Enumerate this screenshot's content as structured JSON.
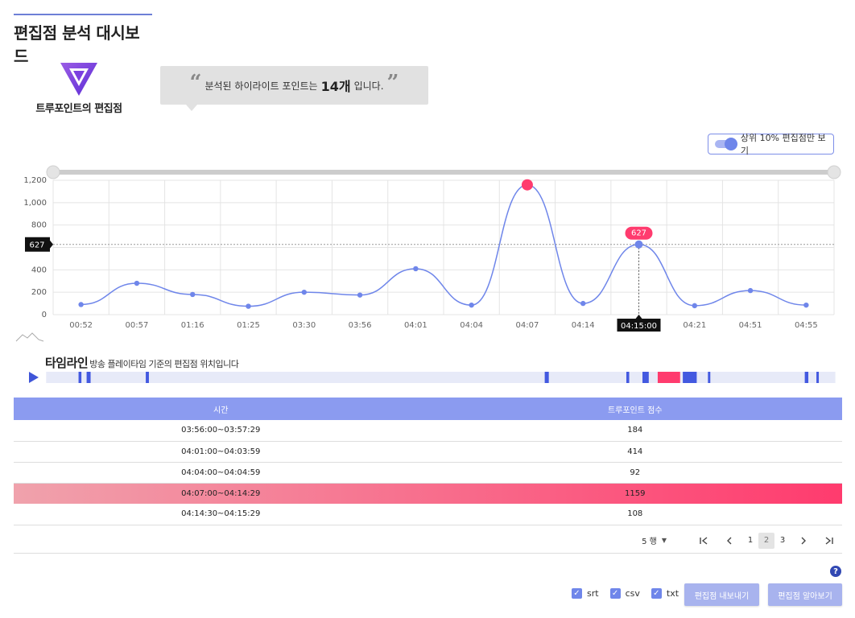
{
  "page": {
    "title": "편집점 분석 대시보드"
  },
  "brand": {
    "name": "트루포인트의 편집점",
    "logo_icon": "v-logo-icon"
  },
  "summary": {
    "before": "분석된 하이라이트 포인트는",
    "count": "14개",
    "after": "입니다."
  },
  "toggle": {
    "label": "상위 10% 편집점만 보기",
    "on": true
  },
  "chart_data": {
    "type": "line",
    "categories": [
      "00:52",
      "00:57",
      "01:16",
      "01:25",
      "03:30",
      "03:56",
      "04:01",
      "04:04",
      "04:07",
      "04:14",
      "04:15:00",
      "04:21",
      "04:51",
      "04:55"
    ],
    "values": [
      90,
      280,
      180,
      75,
      200,
      175,
      410,
      85,
      1159,
      100,
      627,
      80,
      215,
      85
    ],
    "ylim": [
      0,
      1200
    ],
    "yticks": [
      "0",
      "200",
      "400",
      "600",
      "800",
      "1,000",
      "1,200"
    ],
    "highlight_index": 8,
    "selected_index": 10,
    "marker_label": "627",
    "y_marker_label": "627",
    "colors": {
      "line": "#6f86ea",
      "highlight": "#ff3b6e",
      "grid": "#e4e4e4",
      "slider": "#cccccc"
    }
  },
  "timeline": {
    "title": "타임라인",
    "subtitle": "방송 플레이타임 기준의 편집점 위치입니다",
    "play_icon": "play-icon",
    "marks": [
      {
        "pos": 0.2155,
        "w": 0.0032,
        "hl": false
      },
      {
        "pos": 0.2245,
        "w": 0.0045,
        "hl": false
      },
      {
        "pos": 0.2905,
        "w": 0.0035,
        "hl": false
      },
      {
        "pos": 0.7355,
        "w": 0.0045,
        "hl": false
      },
      {
        "pos": 0.8265,
        "w": 0.0032,
        "hl": false
      },
      {
        "pos": 0.8445,
        "w": 0.007,
        "hl": false
      },
      {
        "pos": 0.8615,
        "w": 0.025,
        "hl": true
      },
      {
        "pos": 0.8895,
        "w": 0.0155,
        "hl": false
      },
      {
        "pos": 0.9175,
        "w": 0.0025,
        "hl": false
      },
      {
        "pos": 1.0255,
        "w": 0.004,
        "hl": false
      },
      {
        "pos": 1.0385,
        "w": 0.0025,
        "hl": false
      }
    ]
  },
  "table": {
    "headers": [
      "시간",
      "트루포인트 점수"
    ],
    "rows": [
      {
        "time": "03:56:00~03:57:29",
        "score": "184",
        "highlight": false
      },
      {
        "time": "04:01:00~04:03:59",
        "score": "414",
        "highlight": false
      },
      {
        "time": "04:04:00~04:04:59",
        "score": "92",
        "highlight": false
      },
      {
        "time": "04:07:00~04:14:29",
        "score": "1159",
        "highlight": true
      },
      {
        "time": "04:14:30~04:15:29",
        "score": "108",
        "highlight": false
      }
    ]
  },
  "pagination": {
    "rows_per_page": "5 행",
    "pages": [
      "1",
      "2",
      "3"
    ],
    "current": "2",
    "icons": {
      "first": "first-page-icon",
      "prev": "prev-page-icon",
      "next": "next-page-icon",
      "last": "last-page-icon"
    }
  },
  "help_label": "?",
  "formats": [
    {
      "label": "srt",
      "checked": true
    },
    {
      "label": "csv",
      "checked": true
    },
    {
      "label": "txt",
      "checked": true
    }
  ],
  "buttons": {
    "export": "편집점 내보내기",
    "learn": "편집점 알아보기"
  }
}
